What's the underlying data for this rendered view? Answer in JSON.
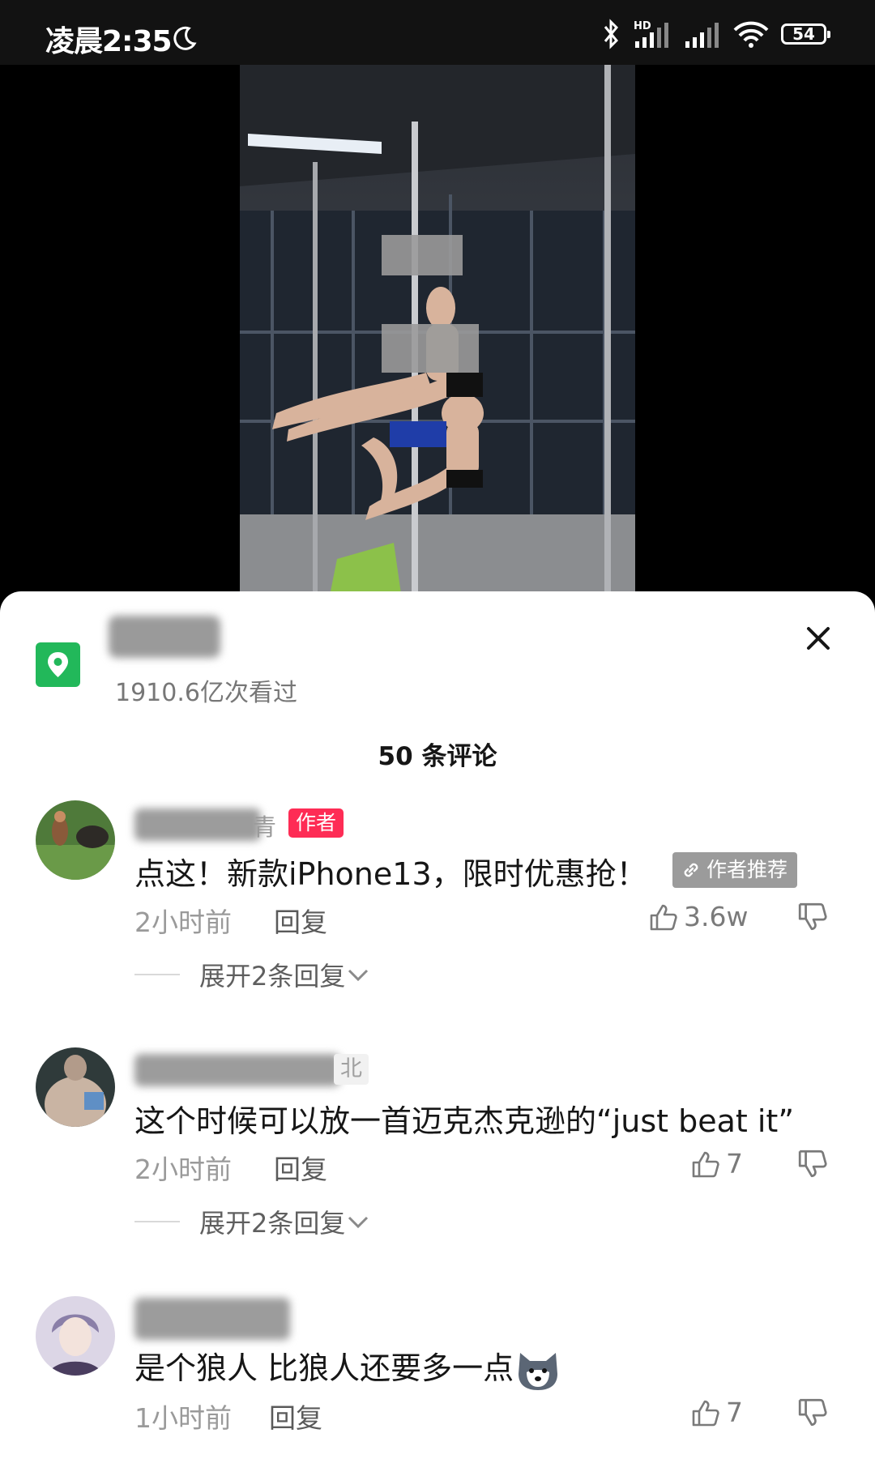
{
  "status_bar": {
    "time": "凌晨2:35",
    "hd_label": "HD",
    "battery": "54"
  },
  "sheet": {
    "views": "1910.6亿次看过",
    "comment_count": "50 条评论"
  },
  "comments": [
    {
      "name_visible_tail": "青",
      "author_badge": "作者",
      "text": "点这！新款iPhone13，限时优惠抢！",
      "recommend_badge": "作者推荐",
      "time": "2小时前",
      "reply": "回复",
      "likes": "3.6w",
      "expand": "展开2条回复"
    },
    {
      "name_visible_tail": "北",
      "text": "这个时候可以放一首迈克杰克逊的“just beat it”",
      "time": "2小时前",
      "reply": "回复",
      "likes": "7",
      "expand": "展开2条回复"
    },
    {
      "text": "是个狼人  比狼人还要多一点",
      "time": "1小时前",
      "reply": "回复",
      "likes": "7"
    }
  ],
  "colors": {
    "accent": "#fe2c55",
    "location_green": "#22b85a",
    "text_primary": "#161616",
    "text_secondary": "#9a9a9a"
  },
  "icons": [
    "moon-icon",
    "bluetooth-icon",
    "signal-icon",
    "wifi-icon",
    "battery-icon",
    "location-icon",
    "close-icon",
    "thumbs-up-icon",
    "thumbs-down-icon",
    "chevron-down-icon",
    "link-icon",
    "dog-emoji-icon"
  ]
}
